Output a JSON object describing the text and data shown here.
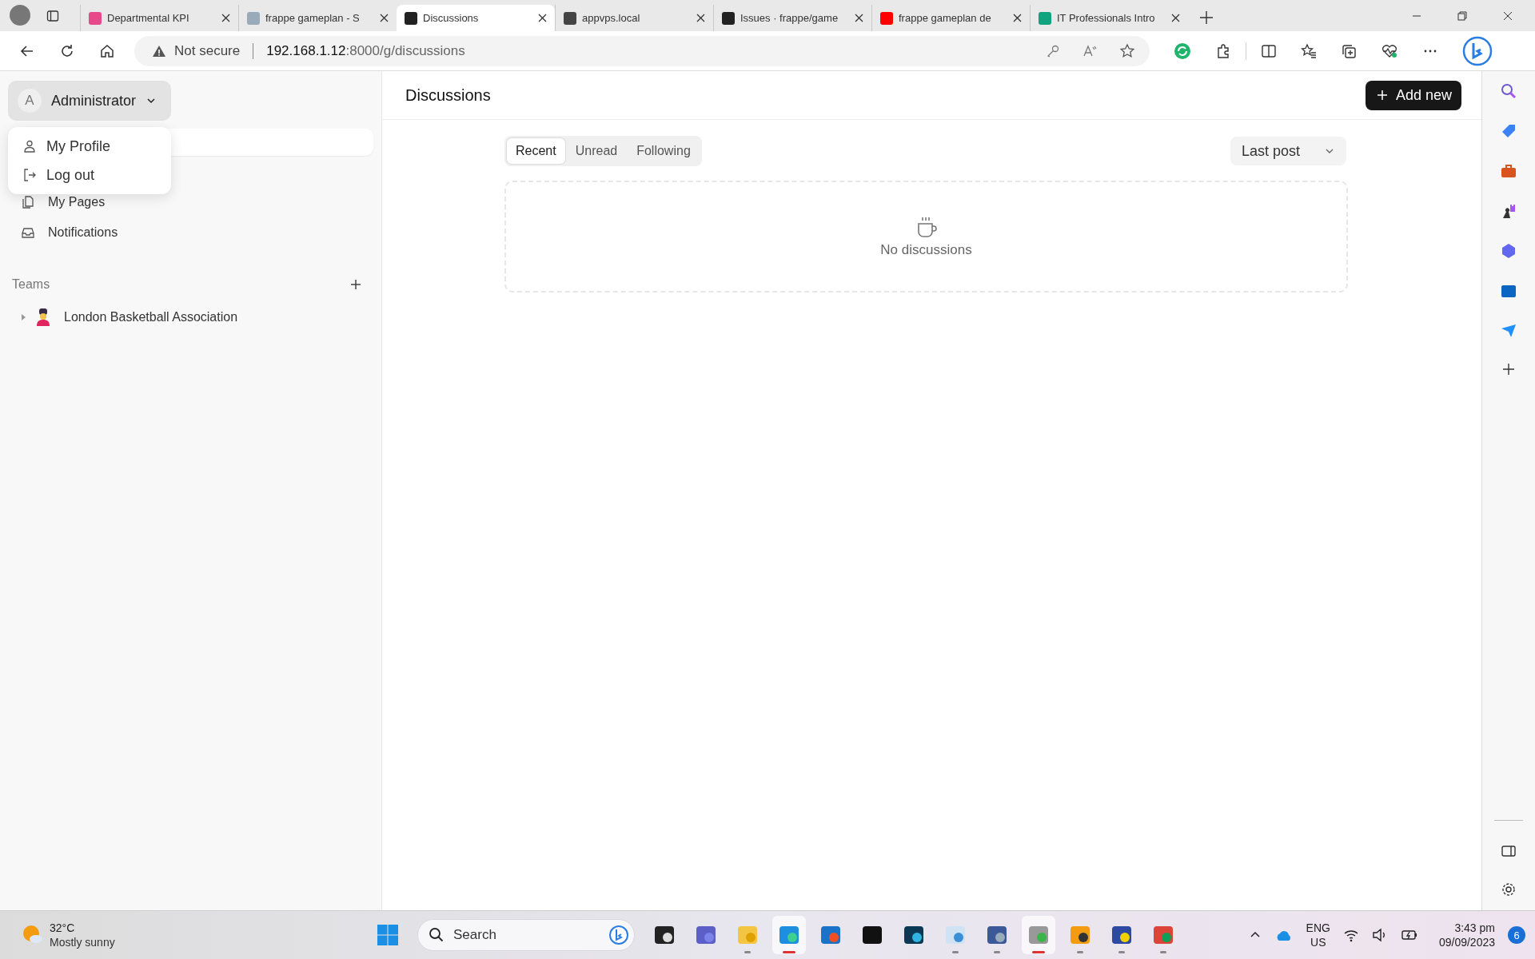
{
  "browser": {
    "tabs": [
      {
        "title": "Departmental KPI",
        "selected": false
      },
      {
        "title": "frappe gameplan - S",
        "selected": false
      },
      {
        "title": "Discussions",
        "selected": true
      },
      {
        "title": "appvps.local",
        "selected": false
      },
      {
        "title": "Issues · frappe/game",
        "selected": false
      },
      {
        "title": "frappe gameplan de",
        "selected": false
      },
      {
        "title": "IT Professionals Intro",
        "selected": false
      }
    ],
    "security": "Not secure",
    "url_host": "192.168.1.12",
    "url_path": ":8000/g/discussions"
  },
  "sidebar": {
    "user": {
      "initial": "A",
      "name": "Administrator"
    },
    "user_menu": [
      {
        "label": "My Profile",
        "kind": "profile"
      },
      {
        "label": "Log out",
        "kind": "logout"
      }
    ],
    "items": [
      {
        "label": "My Pages",
        "kind": "pages"
      },
      {
        "label": "Notifications",
        "kind": "inbox"
      }
    ],
    "teams_heading": "Teams",
    "teams": [
      {
        "name": "London Basketball Association",
        "expanded": false
      }
    ]
  },
  "main": {
    "title": "Discussions",
    "add_button": "Add new",
    "filters": [
      {
        "label": "Recent",
        "selected": true
      },
      {
        "label": "Unread",
        "selected": false
      },
      {
        "label": "Following",
        "selected": false
      }
    ],
    "sort": "Last post",
    "empty_text": "No discussions"
  },
  "taskbar": {
    "temperature": "32°C",
    "weather": "Mostly sunny",
    "search_placeholder": "Search",
    "apps": [
      {
        "running": false,
        "selected": false
      },
      {
        "running": false,
        "selected": false
      },
      {
        "running": true,
        "selected": false
      },
      {
        "running": true,
        "selected": true
      },
      {
        "running": false,
        "selected": false
      },
      {
        "running": false,
        "selected": false
      },
      {
        "running": false,
        "selected": false
      },
      {
        "running": true,
        "selected": false
      },
      {
        "running": true,
        "selected": false
      },
      {
        "running": true,
        "selected": true
      },
      {
        "running": true,
        "selected": false
      },
      {
        "running": true,
        "selected": false
      },
      {
        "running": true,
        "selected": false
      }
    ],
    "language": "ENG",
    "region": "US",
    "time": "3:43 pm",
    "date": "09/09/2023",
    "notifications": "6"
  }
}
